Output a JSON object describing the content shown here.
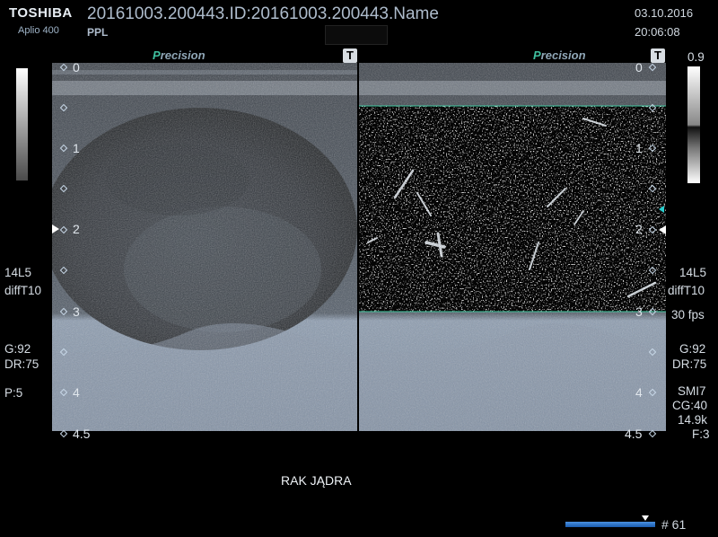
{
  "header": {
    "brand": "TOSHIBA",
    "model": "Aplio 400",
    "patient_line": "20161003.200443.ID:20161003.200443.Name",
    "preset": "PPL",
    "date": "03.10.2016",
    "time": "20:06:08"
  },
  "panels": {
    "precision_label_p": "P",
    "precision_label_rest": "recision",
    "t_label": "T"
  },
  "depth_scale": {
    "labels": [
      "0",
      "1",
      "2",
      "3",
      "4",
      "4.5"
    ]
  },
  "left_params": {
    "probe": "14L5",
    "mode": "diffT10",
    "gain": "G:92",
    "dr": "DR:75",
    "power": "P:5"
  },
  "right_params": {
    "probe": "14L5",
    "mode": "diffT10",
    "fps": "30 fps",
    "gain": "G:92",
    "dr": "DR:75",
    "smi": "SMI7",
    "cg": "CG:40",
    "freq": "14.9k",
    "filter": "F:3",
    "scale_value": "0.9"
  },
  "caption": "RAK JĄDRA",
  "cine": {
    "frame": "# 61",
    "progress": 0.89
  },
  "colors": {
    "roi_line": "#3fc8a0",
    "accent": "#3fbf9f",
    "cine_bar": "#2a6cc8"
  }
}
